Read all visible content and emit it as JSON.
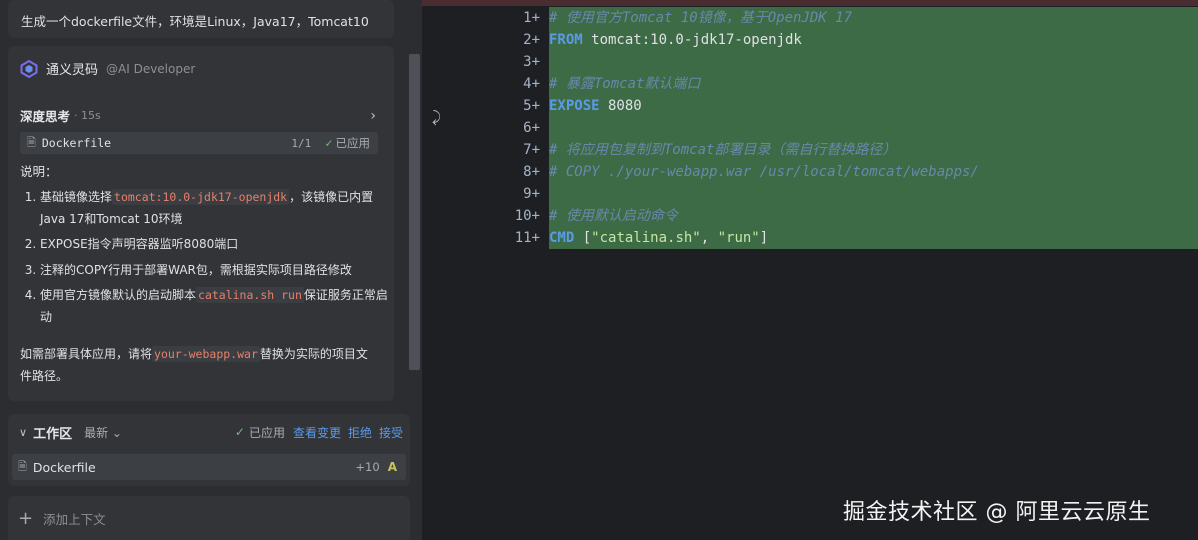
{
  "chat": {
    "user_message": "生成一个dockerfile文件，环境是Linux，Java17，Tomcat10",
    "assistant": {
      "name": "通义灵码",
      "handle": "@AI Developer",
      "thinking_label": "深度思考",
      "thinking_time": "· 15s",
      "file_chip": {
        "name": "Dockerfile",
        "count": "1/1",
        "status": "已应用"
      },
      "explanation_title": "说明：",
      "points": [
        {
          "before": "基础镜像选择",
          "code": "tomcat:10.0-jdk17-openjdk",
          "after": "，该镜像已内置Java 17和Tomcat 10环境"
        },
        {
          "before": "EXPOSE指令声明容器监听8080端口",
          "code": "",
          "after": ""
        },
        {
          "before": "注释的COPY行用于部署WAR包，需根据实际项目路径修改",
          "code": "",
          "after": ""
        },
        {
          "before": "使用官方镜像默认的启动脚本",
          "code": "catalina.sh run",
          "after": "保证服务正常启动"
        }
      ],
      "note_before": "如需部署具体应用，请将",
      "note_code": "your-webapp.war",
      "note_after": "替换为实际的项目文件路径。"
    }
  },
  "workspace": {
    "title": "工作区",
    "sort": "最新",
    "status": "已应用",
    "actions": {
      "view": "查看变更",
      "reject": "拒绝",
      "accept": "接受"
    },
    "file": {
      "name": "Dockerfile",
      "added": "+10",
      "badge": "A"
    }
  },
  "add_context": "添加上下文",
  "editor": {
    "lines": [
      {
        "n": "1+",
        "parts": [
          {
            "t": "# 使用官方Tomcat 10镜像，基于OpenJDK 17",
            "c": "cm"
          }
        ]
      },
      {
        "n": "2+",
        "parts": [
          {
            "t": "FROM",
            "c": "kw"
          },
          {
            "t": " tomcat:10.0-jdk17-openjdk",
            "c": ""
          }
        ]
      },
      {
        "n": "3+",
        "parts": []
      },
      {
        "n": "4+",
        "parts": [
          {
            "t": "# 暴露Tomcat默认端口",
            "c": "cm"
          }
        ]
      },
      {
        "n": "5+",
        "parts": [
          {
            "t": "EXPOSE",
            "c": "kw"
          },
          {
            "t": " 8080",
            "c": ""
          }
        ]
      },
      {
        "n": "6+",
        "parts": []
      },
      {
        "n": "7+",
        "parts": [
          {
            "t": "# 将应用包复制到Tomcat部署目录（需自行替换路径）",
            "c": "cm"
          }
        ]
      },
      {
        "n": "8+",
        "parts": [
          {
            "t": "# COPY ./your-webapp.war /usr/local/tomcat/webapps/",
            "c": "cm"
          }
        ]
      },
      {
        "n": "9+",
        "parts": []
      },
      {
        "n": "10+",
        "parts": [
          {
            "t": "# 使用默认启动命令",
            "c": "cm"
          }
        ]
      },
      {
        "n": "11+",
        "parts": [
          {
            "t": "CMD",
            "c": "kw"
          },
          {
            "t": " [",
            "c": ""
          },
          {
            "t": "\"catalina.sh\"",
            "c": "str"
          },
          {
            "t": ", ",
            "c": ""
          },
          {
            "t": "\"run\"",
            "c": "str"
          },
          {
            "t": "]",
            "c": ""
          }
        ]
      }
    ]
  },
  "watermark": "掘金技术社区 @ 阿里云云原生",
  "colors": {
    "accent": "#5a9be8",
    "diff_added": "#3d6b45",
    "applied_check": "#79b676"
  }
}
